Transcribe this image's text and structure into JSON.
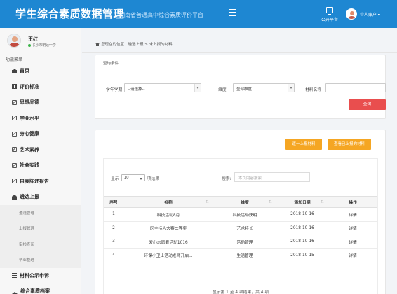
{
  "header": {
    "title": "学生综合素质数据管理",
    "subtitle": "湖南省普通高中综合素质评价平台",
    "public_label": "公开平台",
    "account_label": "个人账户 ▾"
  },
  "user": {
    "name": "王红",
    "school": "长沙市明达中学"
  },
  "sidebar": {
    "nav_title": "功能菜单",
    "items": [
      {
        "label": "首页",
        "icon": "home-icon"
      },
      {
        "label": "评价标准",
        "icon": "book-icon"
      },
      {
        "label": "思想品德",
        "icon": "edit-icon"
      },
      {
        "label": "学业水平",
        "icon": "edit-icon"
      },
      {
        "label": "身心健康",
        "icon": "edit-icon"
      },
      {
        "label": "艺术素养",
        "icon": "edit-icon"
      },
      {
        "label": "社会实践",
        "icon": "edit-icon"
      },
      {
        "label": "自我陈述报告",
        "icon": "edit-icon"
      },
      {
        "label": "遴选上报",
        "icon": "cloud-upload-icon"
      }
    ],
    "sub_items": [
      "遴选管理",
      "上报管理",
      "审核查阅",
      "毕业整理"
    ],
    "bottom_items": [
      {
        "label": "材料公示申诉",
        "icon": "list-icon"
      },
      {
        "label": "综合素质档案",
        "icon": "graduation-cap-icon"
      }
    ]
  },
  "breadcrumb": "您现在的位置：遴选上报 > 未上报的材料",
  "query": {
    "title": "查询条件",
    "year_label": "学年学期",
    "year_value": "--请选择--",
    "dim_label": "维度",
    "dim_value": "全部维度",
    "name_label": "材料名称",
    "name_value": "",
    "search_button": "查询"
  },
  "list": {
    "btn_upload_one": "逐一上报材料",
    "btn_view_uploaded": "查看已上报的材料",
    "show_prefix": "显示",
    "page_size": "10",
    "show_suffix": "项结果",
    "search_label": "搜索:",
    "search_placeholder": "本页内容搜索",
    "columns": [
      "序号",
      "名称",
      "维度",
      "添加日期",
      "操作"
    ],
    "rows": [
      [
        "1",
        "科技活动8月",
        "科技活动获明",
        "2018-10-16",
        "详情"
      ],
      [
        "2",
        "区主持人大赛二等奖",
        "艺术特长",
        "2018-10-16",
        "详情"
      ],
      [
        "3",
        "爱心志愿者活动1016",
        "活动管理",
        "2018-10-16",
        "详情"
      ],
      [
        "4",
        "环保小卫士活动老师开启...",
        "生活管理",
        "2018-10-15",
        "详情"
      ]
    ],
    "info": "显示第 1 至 4 项结果，共 4 项"
  },
  "colors": {
    "header_bg": "#1e87d2",
    "search_button": "#e94e4e",
    "action_buttons": "#f5a623"
  }
}
